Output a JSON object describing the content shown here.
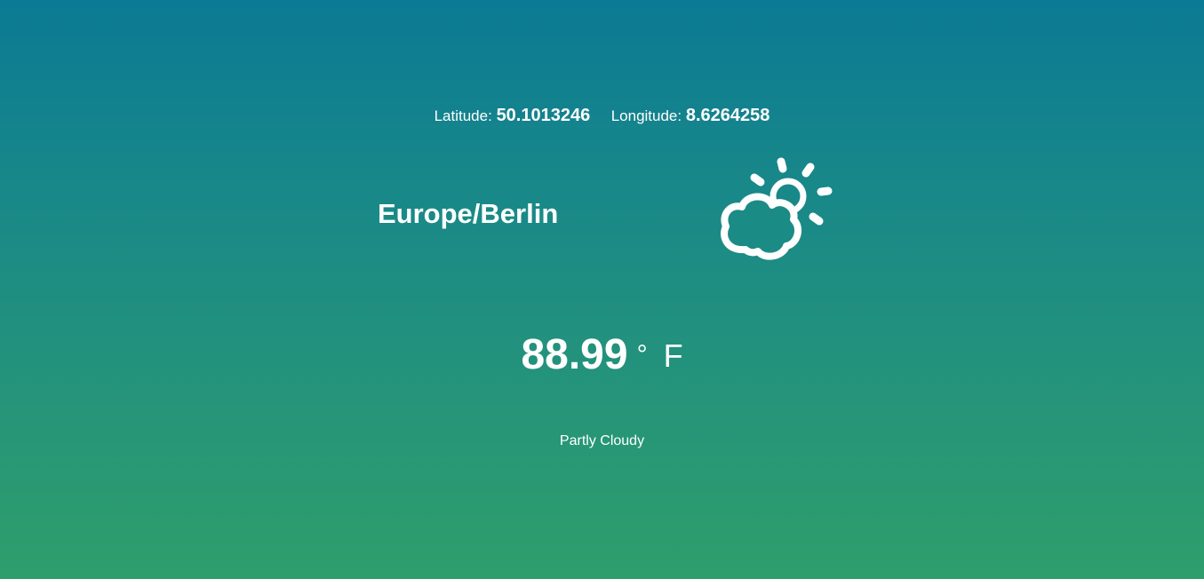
{
  "coordinates": {
    "latitude_label": "Latitude:",
    "latitude_value": "50.1013246",
    "longitude_label": "Longitude:",
    "longitude_value": "8.6264258"
  },
  "location": {
    "timezone": "Europe/Berlin"
  },
  "weather": {
    "icon": "partly-cloudy-day-icon",
    "temperature": "88.99",
    "degree_symbol": "°",
    "unit": "F",
    "summary": "Partly Cloudy"
  },
  "colors": {
    "gradient_top": "#0b7a94",
    "gradient_bottom": "#2e9e6c",
    "text": "#ffffff"
  }
}
